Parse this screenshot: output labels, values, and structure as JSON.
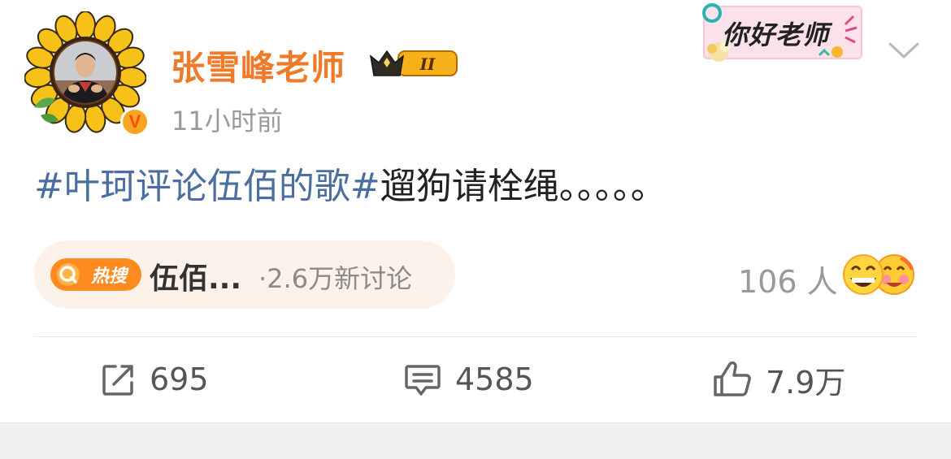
{
  "user": {
    "name": "张雪峰老师",
    "level_badge": "II",
    "verified_mark": "V",
    "time": "11小时前"
  },
  "sticker": {
    "text": "你好老师"
  },
  "post": {
    "hashtag": "#叶珂评论伍佰的歌#",
    "text": "遛狗请栓绳。。。。。"
  },
  "hot": {
    "badge": "热搜",
    "topic": "伍佰...",
    "discuss": "·2.6万新讨论"
  },
  "reactions": {
    "people": "106 人"
  },
  "actions": {
    "repost": "695",
    "comment": "4585",
    "like": "7.9万"
  },
  "colors": {
    "username": "#ef7a2a",
    "hashtag": "#4a6e9f",
    "hot_orange": "#ff8a1f"
  },
  "icons": {
    "menu": "chevron-down-icon",
    "repost": "repost-icon",
    "comment": "comment-icon",
    "like": "thumbs-up-icon"
  }
}
